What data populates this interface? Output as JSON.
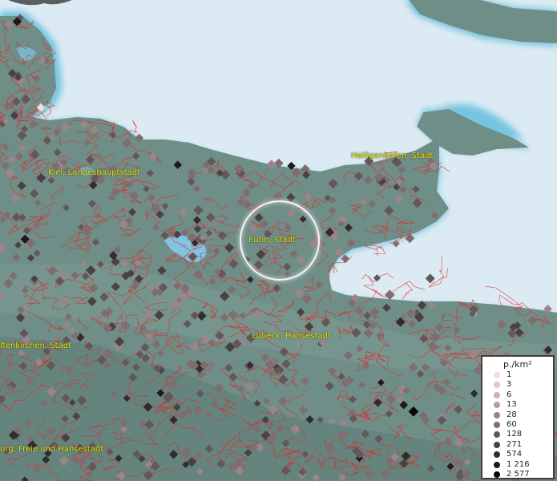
{
  "labels": {
    "heiligenhafen": "Heiligenhafen, Stadt",
    "kiel": "Kiel, Landeshauptstadt",
    "eutin": "Eutin, Stadt",
    "luebeck": "Lübeck, Hansestadt",
    "altenkirchen": "ltenkirchen, Stadt",
    "hamburg": "urg, Freie und Hansestadt"
  },
  "legend": {
    "title": "p./km²",
    "items": [
      {
        "label": "1",
        "color": "#f3dcdc"
      },
      {
        "label": "3",
        "color": "#e2c7c9"
      },
      {
        "label": "6",
        "color": "#cdb0b4"
      },
      {
        "label": "13",
        "color": "#b59ca0"
      },
      {
        "label": "28",
        "color": "#9b8589"
      },
      {
        "label": "60",
        "color": "#7f6d70"
      },
      {
        "label": "128",
        "color": "#655759"
      },
      {
        "label": "271",
        "color": "#4b4143"
      },
      {
        "label": "574",
        "color": "#332c2e"
      },
      {
        "label": "1 216",
        "color": "#1e1a1b"
      },
      {
        "label": "2 577",
        "color": "#080707"
      }
    ]
  },
  "colors": {
    "sea": "#dcebf3",
    "coast": "#74c1dc",
    "land": "#6e8e86",
    "borders": "#e02020",
    "highlight": "#ffffff"
  }
}
